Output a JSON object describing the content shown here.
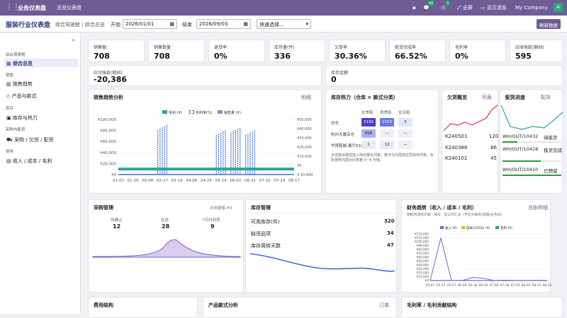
{
  "topbar": {
    "app_name": "业务仪表盘",
    "menu": "总览仪表盘",
    "chat_badge": "40",
    "activity_badge": "3",
    "fullscreen": "全屏",
    "show_msgs": "显示消息",
    "company": "My Company",
    "avatar_letter": "A"
  },
  "controls": {
    "title": "服装行业仪表盘",
    "breadcrumb": "综合驾驶舱 / 综合总览",
    "start_label": "开始",
    "start_date": "2026/01/01",
    "end_label": "结束",
    "end_date": "2026/09/03",
    "quick_select": "快速选择...",
    "refresh": "刷新数据"
  },
  "sidebar": {
    "sections": [
      {
        "title": "综合驾驶舱",
        "items": [
          "综合总览"
        ]
      },
      {
        "title": "销售",
        "items": [
          "销售趋势",
          "产品与款式"
        ]
      },
      {
        "title": "库存",
        "items": [
          "库存与热力"
        ]
      },
      {
        "title": "采购与配货",
        "items": [
          "采购 / 欠货 / 配货"
        ]
      },
      {
        "title": "财务",
        "items": [
          "收入 / 成本 / 毛利"
        ]
      }
    ]
  },
  "kpis": [
    {
      "label": "销售额",
      "value": "708"
    },
    {
      "label": "销售数量",
      "value": "708"
    },
    {
      "label": "退货率",
      "value": "0%"
    },
    {
      "label": "库存量(件)",
      "value": "336"
    },
    {
      "label": "欠单率",
      "value": "30.36%"
    },
    {
      "label": "配货完成率",
      "value": "66.52%"
    },
    {
      "label": "毛利率",
      "value": "0%"
    },
    {
      "label": "应收账款(期间)",
      "value": "595"
    },
    {
      "label": "应付账款(期间)",
      "value": "-20,386"
    },
    {
      "label": "库存金额",
      "value": "0"
    }
  ],
  "sales_trend": {
    "title": "销售趋势分析",
    "link": "明细",
    "legend": [
      "毛利 (¥)",
      "毛利率(%)",
      "销售量 (V)"
    ]
  },
  "heatmap": {
    "title": "库存热力（仓库 × 款式分类）",
    "cols": [
      "女季鞋",
      "男季鞋",
      "女凉鞋"
    ],
    "rows": [
      {
        "name": "总仓",
        "cells": [
          "2199",
          "1503",
          "5"
        ]
      },
      {
        "name": "杭州大厦店仓",
        "cells": [
          "898",
          "—",
          "—"
        ]
      },
      {
        "name": "华贸鞋城-展厅618#",
        "cells": [
          "1",
          "12",
          "—"
        ]
      }
    ],
    "note": "点击数块按钮进入库存量化列表，数字为内层库位层库存件数。色阶按照内层对比限量 0~4 分级。"
  },
  "shortage": {
    "title": "欠货概览",
    "link": "列表",
    "rows": [
      {
        "name": "K240501",
        "value": "120"
      },
      {
        "name": "K240388",
        "value": "86"
      },
      {
        "name": "K240102",
        "value": "45"
      }
    ]
  },
  "delivery": {
    "title": "配货进度",
    "link": "配货",
    "rows": [
      {
        "name": "WH/OUT/10432",
        "status": "待拣货"
      },
      {
        "name": "WH/OUT/10428",
        "status": "拣货完成"
      },
      {
        "name": "WH/OUT/10410",
        "status": "已预留"
      }
    ]
  },
  "purchase": {
    "title": "采购管理",
    "link": "点击链接 PO",
    "cols": [
      {
        "label": "待确认",
        "value": "12"
      },
      {
        "label": "在途",
        "value": "28"
      },
      {
        "label": "7日内到货",
        "value": "9"
      }
    ]
  },
  "inventory": {
    "title": "库存管理",
    "rows": [
      {
        "label": "可用库存(件)",
        "value": "320"
      },
      {
        "label": "缺货品项",
        "value": "34"
      },
      {
        "label": "库存周转天数",
        "value": "47"
      }
    ]
  },
  "finance": {
    "title": "财务趋势（收入 / 成本 / 毛利）",
    "link": "总账明细",
    "subtitle": "销售利润统计表 · 按日 · 全公司汇总（不区分账号/店铺/业务员）",
    "legend": [
      "收入 (¥)",
      "成本(COGS) (¥)",
      "毛利 (¥)"
    ]
  },
  "bottom": {
    "expense": "费用结构",
    "product": "产品款式分析",
    "product_link": "订单",
    "margin": "毛利率 / 毛利贡献结构"
  },
  "colors": {
    "brand": "#6f5c96",
    "teal": "#26a69a",
    "blue": "#3b6fd8",
    "purple": "#7b61d9",
    "red": "#d2363c",
    "green": "#2e9a3a"
  },
  "chart_data": [
    {
      "type": "bar",
      "title": "销售趋势分析",
      "x": [
        "01-01",
        "01-20",
        "02-08",
        "02-27",
        "03-18",
        "04-06",
        "04-25",
        "05-14",
        "06-02",
        "06-21",
        "07-10",
        "07-29",
        "08-17"
      ],
      "ylim": [
        0,
        100000
      ],
      "y2lim": [
        -10000,
        50000
      ],
      "y_ticks": [
        "¥100,000",
        "¥80,000",
        "¥60,000",
        "¥40,000",
        "¥20,000",
        "¥0"
      ],
      "y2_ticks": [
        "¥50,000",
        "¥40,000",
        "¥30,000",
        "¥20,000",
        "¥10,000",
        "¥0",
        "¥-10,000"
      ],
      "series": [
        {
          "name": "毛利 (¥)",
          "values": [
            10000,
            10000,
            10000,
            10000,
            10000,
            10000,
            10000,
            10000,
            10000,
            10000,
            10000,
            10000,
            10000
          ]
        },
        {
          "name": "毛利率(%)",
          "values": []
        },
        {
          "name": "销售量 (V)",
          "values": [
            0,
            0,
            0,
            90000,
            0,
            0,
            0,
            80000,
            85000,
            80000,
            0,
            0,
            0
          ]
        }
      ]
    },
    {
      "type": "line",
      "title": "财务趋势（收入 / 成本 / 毛利）",
      "x": [
        "05-07",
        "05-17",
        "05-27",
        "06-06",
        "06-16",
        "06-26",
        "07-06",
        "07-16",
        "07-26",
        "08-05",
        "08-15",
        "08-25"
      ],
      "ylim": [
        0,
        120000
      ],
      "y_ticks": [
        "¥120,000",
        "¥110,000",
        "¥100,000",
        "¥90,000",
        "¥80,000",
        "¥70,000",
        "¥60,000",
        "¥50,000",
        "¥40,000",
        "¥30,000",
        "¥20,000",
        "¥10,000",
        "¥0"
      ],
      "series": [
        {
          "name": "收入 (¥)",
          "values": [
            0,
            110000,
            0,
            0,
            8000,
            6000,
            0,
            1000,
            0,
            0,
            500,
            500
          ]
        },
        {
          "name": "成本(COGS) (¥)",
          "values": [
            0,
            0,
            0,
            0,
            0,
            0,
            0,
            0,
            0,
            0,
            0,
            0
          ]
        },
        {
          "name": "毛利 (¥)",
          "values": [
            0,
            0,
            0,
            0,
            0,
            0,
            0,
            0,
            0,
            0,
            0,
            0
          ]
        }
      ]
    }
  ]
}
